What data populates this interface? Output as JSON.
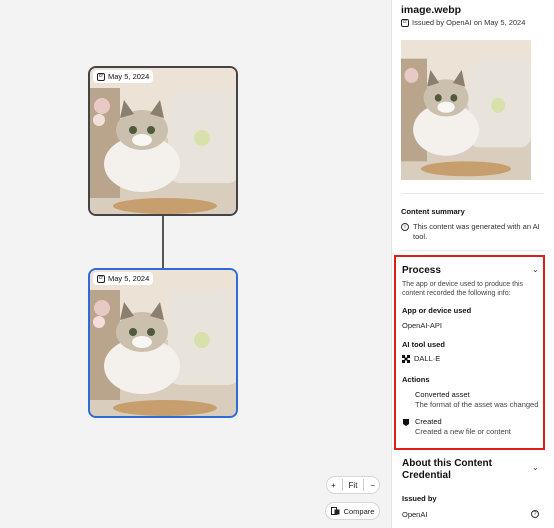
{
  "canvas": {
    "node1_date": "May 5, 2024",
    "node2_date": "May 5, 2024",
    "zoom_in": "+",
    "zoom_fit": "Fit",
    "zoom_out": "−",
    "compare_label": "Compare"
  },
  "panel": {
    "file_name": "image.webp",
    "issued_by": "Issued by OpenAI on May 5, 2024",
    "content_summary_title": "Content summary",
    "content_summary_text": "This content was generated with an AI tool.",
    "process": {
      "title": "Process",
      "description": "The app or device used to produce this content recorded the following info:",
      "app_label": "App or device used",
      "app_value": "OpenAI-API",
      "ai_tool_label": "AI tool used",
      "ai_tool_value": "DALL·E",
      "actions_label": "Actions",
      "actions": [
        {
          "title": "Converted asset",
          "subtitle": "The format of the asset was changed"
        },
        {
          "title": "Created",
          "subtitle": "Created a new file or content"
        }
      ]
    },
    "about": {
      "title": "About this Content Credential",
      "issued_by_label": "Issued by",
      "issued_by_value": "OpenAI"
    }
  },
  "colors": {
    "highlight": "#e01d1d",
    "selected_node": "#2f6bd6"
  }
}
